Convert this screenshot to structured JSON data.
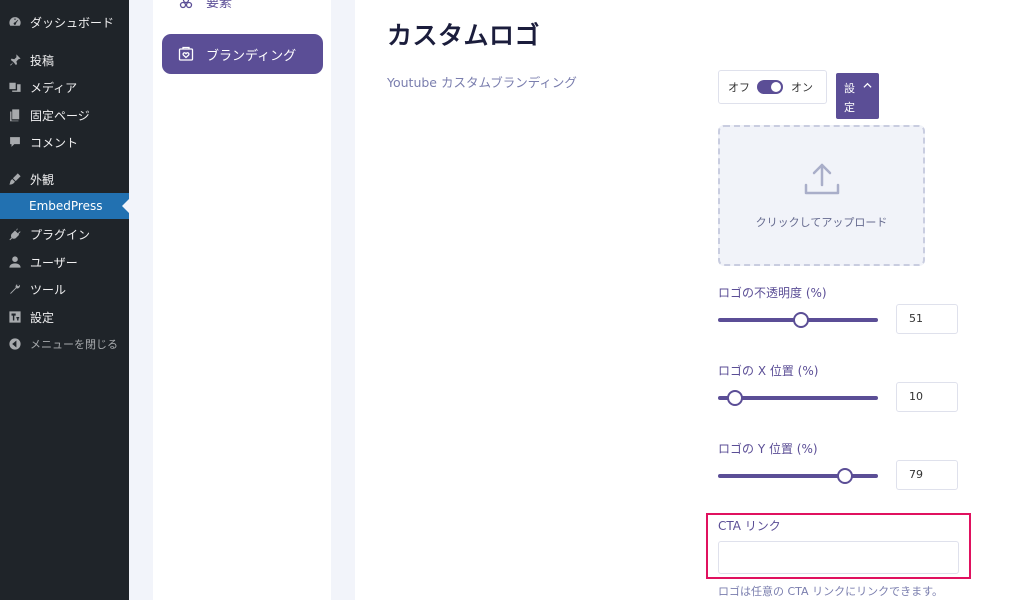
{
  "wp_menu": {
    "items": [
      {
        "label": "ダッシュボード",
        "icon": "dashboard-icon"
      },
      {
        "label": "投稿",
        "icon": "pin-icon"
      },
      {
        "label": "メディア",
        "icon": "media-icon"
      },
      {
        "label": "固定ページ",
        "icon": "page-icon"
      },
      {
        "label": "コメント",
        "icon": "comment-icon"
      },
      {
        "label": "外観",
        "icon": "brush-icon"
      },
      {
        "label": "EmbedPress",
        "icon": ""
      },
      {
        "label": "プラグイン",
        "icon": "plugin-icon"
      },
      {
        "label": "ユーザー",
        "icon": "user-icon"
      },
      {
        "label": "ツール",
        "icon": "wrench-icon"
      },
      {
        "label": "設定",
        "icon": "settings-icon"
      },
      {
        "label": "メニューを閉じる",
        "icon": "collapse-icon"
      }
    ],
    "active_color": "#2271b1"
  },
  "plugin_nav": {
    "elements_label": "要素",
    "branding_label": "ブランディング",
    "accent": "#5b4e96"
  },
  "main": {
    "title": "カスタムロゴ",
    "row_label": "Youtube カスタムブランディング",
    "toggle": {
      "off_label": "オフ",
      "on_label": "オン",
      "state": "on"
    },
    "settings_button": "設定",
    "upload_text": "クリックしてアップロード",
    "sliders": [
      {
        "label": "ロゴの不透明度 (%)",
        "value": "51",
        "fraction": 0.51
      },
      {
        "label": "ロゴの X 位置 (%)",
        "value": "10",
        "fraction": 0.1
      },
      {
        "label": "ロゴの Y 位置 (%)",
        "value": "79",
        "fraction": 0.79
      }
    ],
    "cta": {
      "label": "CTA リンク",
      "value": "",
      "help": "ロゴは任意の CTA リンクにリンクできます。",
      "highlight_color": "#e0115f"
    }
  }
}
